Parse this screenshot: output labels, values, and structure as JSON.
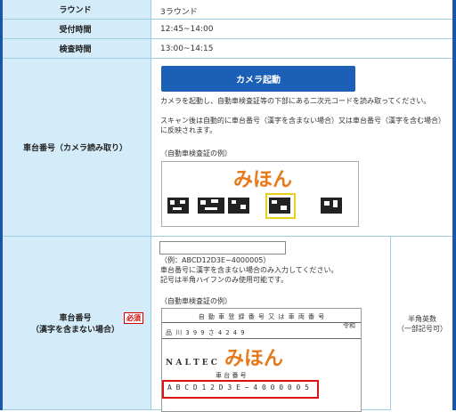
{
  "rows": [
    {
      "label": "ラウンド",
      "value": "3ラウンド"
    },
    {
      "label": "受付時間",
      "value": "12:45~14:00"
    },
    {
      "label": "検査時間",
      "value": "13:00~14:15"
    }
  ],
  "camera_row": {
    "label": "車台番号（カメラ読み取り）",
    "button_label": "カメラ起動",
    "desc1": "カメラを起動し、自動車検査証等の下部にある二次元コードを読み取ってください。",
    "desc2": "スキャン後は自動的に車台番号（漢字を含まない場合）又は車台番号（漢字を含む場合）に反映されます。",
    "example_caption": "（自動車検査証の例）",
    "example_mark": "みほん"
  },
  "manual_row": {
    "label_line1": "車台番号",
    "label_line2": "（漢字を含まない場合）",
    "required_badge": "必須",
    "input_value": "",
    "hint1": "（例：ABCD12D3E−4000005）",
    "hint2": "車台番号に漢字を含まない場合のみ入力してください。",
    "hint3": "記号は半角ハイフンのみ使用可能です。",
    "example_caption": "（自動車検査証の例）",
    "cert_header": "自 動 車 登 録 番 号 又 は 車 両 番 号",
    "cert_plate": "品 川   3 9 9   さ   4 2 4 9",
    "cert_reiwa": "令和",
    "cert_name": "N A L T E C",
    "cert_daiban": "車   台   番   号",
    "cert_vin": "A B C D 1 2 D 3 E − 4 0 0 0 0 0 5",
    "example_mark": "みほん",
    "right_note_line1": "半角英数",
    "right_note_line2": "（一部記号可）"
  }
}
